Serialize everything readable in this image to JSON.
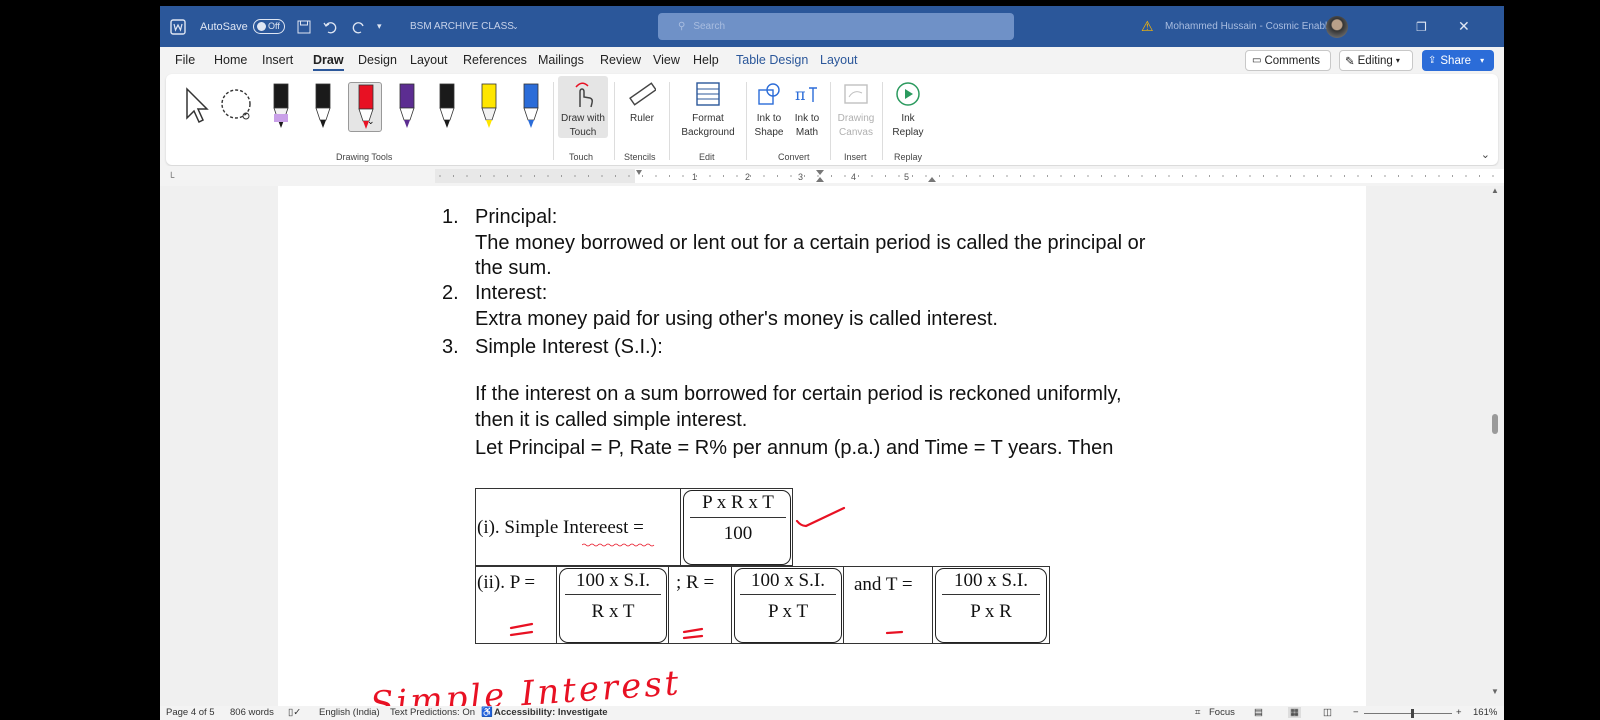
{
  "titlebar": {
    "autosave_label": "AutoSave",
    "autosave_state": "Off",
    "doc_name": "BSM ARCHIVE CLASS",
    "search_placeholder": "Search",
    "user_name": "Mohammed Hussain - Cosmic Enablers"
  },
  "menu_tabs": [
    "File",
    "Home",
    "Insert",
    "Draw",
    "Design",
    "Layout",
    "References",
    "Mailings",
    "Review",
    "View",
    "Help",
    "Table Design",
    "Layout"
  ],
  "active_tab": "Draw",
  "header_buttons": {
    "comments": "Comments",
    "editing": "Editing",
    "share": "Share"
  },
  "ribbon": {
    "draw_with_touch": "Draw with Touch",
    "ruler": "Ruler",
    "format_background": "Format Background",
    "ink_to_shape": "Ink to Shape",
    "ink_to_math": "Ink to Math",
    "drawing_canvas": "Drawing Canvas",
    "ink_replay": "Ink Replay",
    "groups": {
      "drawing_tools": "Drawing Tools",
      "touch": "Touch",
      "stencils": "Stencils",
      "edit": "Edit",
      "convert": "Convert",
      "insert": "Insert",
      "replay": "Replay"
    },
    "pen_colors": [
      "#1a1a1a",
      "#1a1a1a",
      "#e81123",
      "#5c2d91",
      "#1a1a1a",
      "#ffe600",
      "#2b6cd8"
    ]
  },
  "ruler_numbers": [
    "1",
    "2",
    "3",
    "4",
    "5"
  ],
  "document": {
    "item1_num": "1.",
    "item1_title": "Principal:",
    "item1_line1": "The money borrowed or lent out for a certain period is called the principal or",
    "item1_line2": "the sum.",
    "item2_num": "2.",
    "item2_title": "Interest:",
    "item2_line1": "Extra money paid for using other's money is called interest.",
    "item3_num": "3.",
    "item3_title": "Simple Interest (S.I.):",
    "para1": "If the interest on a sum borrowed for certain period is reckoned uniformly,",
    "para2": "then it is called simple interest.",
    "para3": "Let Principal = P, Rate = R% per annum (p.a.) and Time = T years. Then",
    "formula": {
      "row1_label": "(i). Simple Intereest =",
      "row1_num": "P x R x T",
      "row1_den": "100",
      "p_label": "(ii). P =",
      "p_num": "100 x S.I.",
      "p_den": "R x T",
      "r_label": "; R =",
      "r_num": "100 x S.I.",
      "r_den": "P x T",
      "t_label": "and T =",
      "t_num": "100 x S.I.",
      "t_den": "P x R"
    },
    "handwriting": "Simple Interest"
  },
  "ink_color": "#e81123",
  "status": {
    "page": "Page 4 of 5",
    "words": "806 words",
    "language": "English (India)",
    "text_predictions": "Text Predictions: On",
    "accessibility": "Accessibility: Investigate",
    "focus": "Focus",
    "zoom": "161%"
  }
}
